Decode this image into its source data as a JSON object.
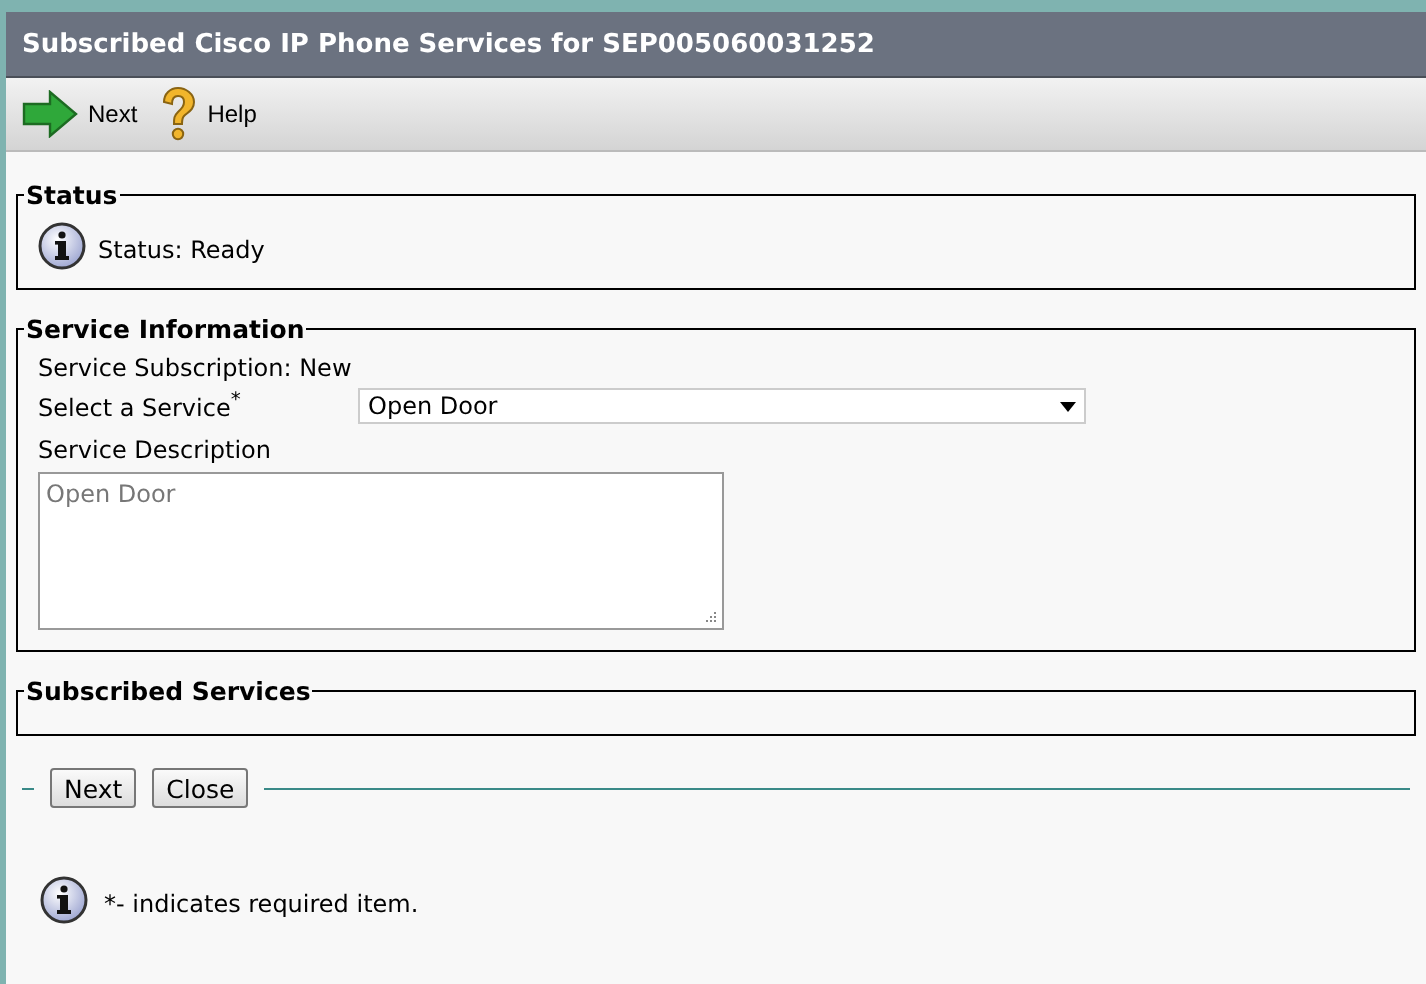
{
  "window": {
    "title": "Subscribed Cisco IP Phone Services for SEP005060031252"
  },
  "toolbar": [
    {
      "kind": "next",
      "label": "Next"
    },
    {
      "kind": "help",
      "label": "Help"
    }
  ],
  "status": {
    "legend": "Status",
    "text": "Status: Ready"
  },
  "service_information": {
    "legend": "Service Information",
    "subscription": "Service Subscription: New",
    "select_label": "Select a Service$^{*}$",
    "select_value": "Open Door",
    "description_label": "Service Description",
    "description_value": "Open Door"
  },
  "subscribed_services": {
    "legend": "Subscribed Services"
  },
  "buttons": [
    "Next",
    "Close"
  ],
  "note": "*- indicates required item."
}
